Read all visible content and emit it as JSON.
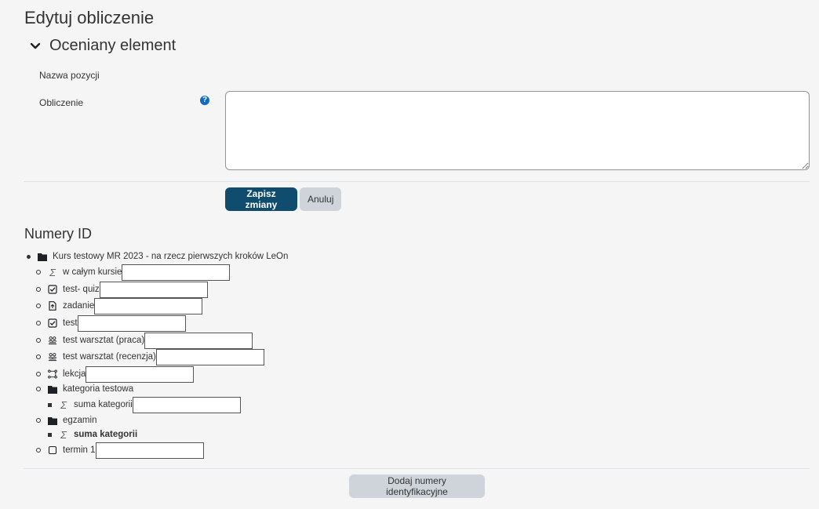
{
  "page": {
    "title": "Edytuj obliczenie"
  },
  "section": {
    "title": "Oceniany element"
  },
  "form": {
    "item_name_label": "Nazwa pozycji",
    "calculation_label": "Obliczenie",
    "calculation_value": "",
    "help_icon": "question-circle-icon"
  },
  "buttons": {
    "save": "Zapisz zmiany",
    "cancel": "Anuluj",
    "add_ids": "Dodaj numery identyfikacyjne"
  },
  "id_numbers": {
    "title": "Numery ID",
    "course": {
      "label": "Kurs testowy MR 2023 - na rzecz pierwszych kroków LeOn",
      "icon": "folder-icon"
    },
    "items": [
      {
        "label": "w całym kursie",
        "icon": "sigma-icon",
        "value": ""
      },
      {
        "label": "test- quiz",
        "icon": "checkbox-icon",
        "value": ""
      },
      {
        "label": "zadanie",
        "icon": "assignment-icon",
        "value": ""
      },
      {
        "label": "test",
        "icon": "checkbox-icon",
        "value": ""
      },
      {
        "label": "test warsztat (praca)",
        "icon": "workshop-icon",
        "value": ""
      },
      {
        "label": "test warsztat (recenzja)",
        "icon": "workshop-icon",
        "value": ""
      },
      {
        "label": "lekcja",
        "icon": "lesson-icon",
        "value": ""
      },
      {
        "label": "kategoria testowa",
        "icon": "folder-icon"
      },
      {
        "label": "suma kategorii",
        "icon": "sigma-icon",
        "value": ""
      },
      {
        "label": "egzamin",
        "icon": "folder-icon"
      },
      {
        "label": "suma kategorii",
        "icon": "sigma-icon"
      },
      {
        "label": "termin 1",
        "icon": "empty-checkbox-icon",
        "value": ""
      }
    ]
  }
}
